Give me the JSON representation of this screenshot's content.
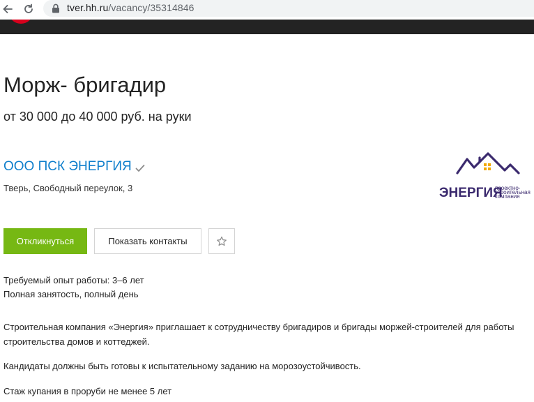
{
  "browser": {
    "url_host": "tver.hh.ru",
    "url_path": "/vacancy/35314846"
  },
  "vacancy": {
    "title": "Морж- бригадир",
    "salary": "от 30 000 до 40 000 руб. на руки"
  },
  "company": {
    "name": "ООО ПСК ЭНЕРГИЯ",
    "address": "Тверь, Свободный переулок, 3",
    "logo": {
      "main_text": "ЭНЕРГИЯ",
      "sub_line1": "проектно-",
      "sub_line2": "строительная",
      "sub_line3": "компания",
      "color": "#3b2a6e"
    }
  },
  "actions": {
    "apply_label": "Откликнуться",
    "contacts_label": "Показать контакты"
  },
  "details": {
    "experience": "Требуемый опыт работы: 3–6 лет",
    "employment": "Полная занятость, полный день"
  },
  "description": {
    "p1": "Строительная компания «Энергия» приглашает к сотрудничеству бригадиров и бригады моржей-строителей для работы строительства домов и коттеджей.",
    "p2": "Кандидаты должны быть готовы к испытательному заданию на морозоустойчивость.",
    "p3": "Стаж купания в проруби не менее 5 лет"
  },
  "colors": {
    "apply_green": "#76b813",
    "link_blue": "#0f7fcc",
    "header_dark": "#232323",
    "brand_red": "#d6001c"
  }
}
